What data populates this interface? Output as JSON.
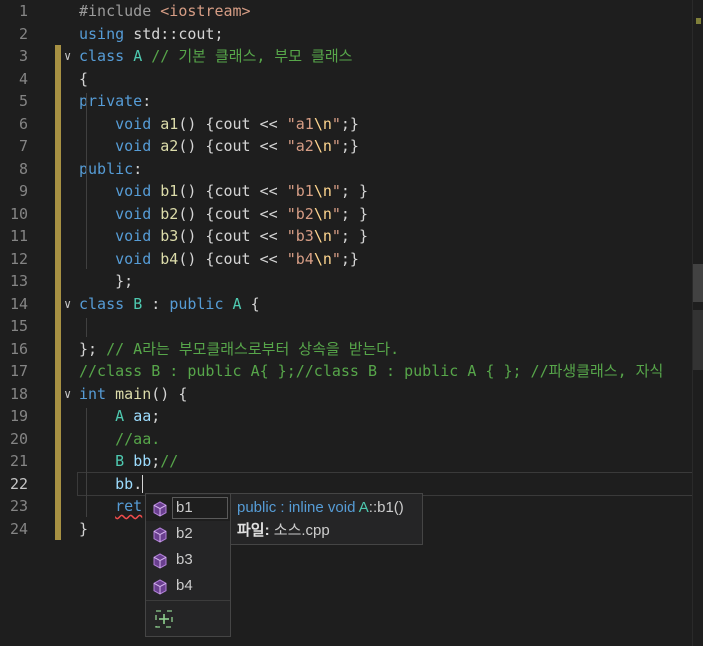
{
  "editor": {
    "current_line": 22,
    "lines": [
      {
        "n": "1",
        "tokens": [
          [
            "pp",
            "#include "
          ],
          [
            "st",
            "<iostream>"
          ]
        ]
      },
      {
        "n": "2",
        "tokens": [
          [
            "kw",
            "using "
          ],
          [
            "pr",
            "std::cout;"
          ]
        ]
      },
      {
        "n": "3",
        "fold": true,
        "tokens": [
          [
            "kw",
            "class "
          ],
          [
            "ty",
            "A"
          ],
          [
            "cm",
            " // 기본 클래스, 부모 클래스"
          ]
        ]
      },
      {
        "n": "4",
        "tokens": [
          [
            "pr",
            "{"
          ]
        ]
      },
      {
        "n": "5",
        "tokens": [
          [
            "kw",
            "private"
          ],
          [
            "pr",
            ":"
          ]
        ]
      },
      {
        "n": "6",
        "tokens": [
          [
            "pr",
            "    "
          ],
          [
            "kw",
            "void "
          ],
          [
            "fn",
            "a1"
          ],
          [
            "pr",
            "() {cout << "
          ],
          [
            "st",
            "\"a1"
          ],
          [
            "es",
            "\\n"
          ],
          [
            "st",
            "\""
          ],
          [
            "pr",
            ";}"
          ]
        ]
      },
      {
        "n": "7",
        "tokens": [
          [
            "pr",
            "    "
          ],
          [
            "kw",
            "void "
          ],
          [
            "fn",
            "a2"
          ],
          [
            "pr",
            "() {cout << "
          ],
          [
            "st",
            "\"a2"
          ],
          [
            "es",
            "\\n"
          ],
          [
            "st",
            "\""
          ],
          [
            "pr",
            ";}"
          ]
        ]
      },
      {
        "n": "8",
        "tokens": [
          [
            "kw",
            "public"
          ],
          [
            "pr",
            ":"
          ]
        ]
      },
      {
        "n": "9",
        "tokens": [
          [
            "pr",
            "    "
          ],
          [
            "kw",
            "void "
          ],
          [
            "fn",
            "b1"
          ],
          [
            "pr",
            "() {cout << "
          ],
          [
            "st",
            "\"b1"
          ],
          [
            "es",
            "\\n"
          ],
          [
            "st",
            "\""
          ],
          [
            "pr",
            "; }"
          ]
        ]
      },
      {
        "n": "10",
        "tokens": [
          [
            "pr",
            "    "
          ],
          [
            "kw",
            "void "
          ],
          [
            "fn",
            "b2"
          ],
          [
            "pr",
            "() {cout << "
          ],
          [
            "st",
            "\"b2"
          ],
          [
            "es",
            "\\n"
          ],
          [
            "st",
            "\""
          ],
          [
            "pr",
            "; }"
          ]
        ]
      },
      {
        "n": "11",
        "tokens": [
          [
            "pr",
            "    "
          ],
          [
            "kw",
            "void "
          ],
          [
            "fn",
            "b3"
          ],
          [
            "pr",
            "() {cout << "
          ],
          [
            "st",
            "\"b3"
          ],
          [
            "es",
            "\\n"
          ],
          [
            "st",
            "\""
          ],
          [
            "pr",
            "; }"
          ]
        ]
      },
      {
        "n": "12",
        "tokens": [
          [
            "pr",
            "    "
          ],
          [
            "kw",
            "void "
          ],
          [
            "fn",
            "b4"
          ],
          [
            "pr",
            "() {cout << "
          ],
          [
            "st",
            "\"b4"
          ],
          [
            "es",
            "\\n"
          ],
          [
            "st",
            "\""
          ],
          [
            "pr",
            ";}"
          ]
        ]
      },
      {
        "n": "13",
        "tokens": [
          [
            "pr",
            "    };"
          ]
        ]
      },
      {
        "n": "14",
        "fold": true,
        "tokens": [
          [
            "kw",
            "class "
          ],
          [
            "ty",
            "B"
          ],
          [
            "pr",
            " : "
          ],
          [
            "kw",
            "public "
          ],
          [
            "ty",
            "A"
          ],
          [
            "pr",
            " {"
          ]
        ]
      },
      {
        "n": "15",
        "tokens": []
      },
      {
        "n": "16",
        "tokens": [
          [
            "pr",
            "}; "
          ],
          [
            "cm",
            "// A라는 부모클래스로부터 상속을 받는다."
          ]
        ]
      },
      {
        "n": "17",
        "tokens": [
          [
            "cm",
            "//class B : public A{ };//class B : public A { }; //파생클래스, 자식"
          ]
        ]
      },
      {
        "n": "18",
        "fold": true,
        "tokens": [
          [
            "kw",
            "int "
          ],
          [
            "fn",
            "main"
          ],
          [
            "pr",
            "() {"
          ]
        ]
      },
      {
        "n": "19",
        "tokens": [
          [
            "pr",
            "    "
          ],
          [
            "ty",
            "A "
          ],
          [
            "va",
            "aa"
          ],
          [
            "pr",
            ";"
          ]
        ]
      },
      {
        "n": "20",
        "tokens": [
          [
            "pr",
            "    "
          ],
          [
            "cm",
            "//aa."
          ]
        ]
      },
      {
        "n": "21",
        "tokens": [
          [
            "pr",
            "    "
          ],
          [
            "ty",
            "B "
          ],
          [
            "va",
            "bb"
          ],
          [
            "pr",
            ";"
          ],
          [
            "cm",
            "//"
          ]
        ]
      },
      {
        "n": "22",
        "tokens": [
          [
            "pr",
            "    "
          ],
          [
            "va",
            "bb"
          ],
          [
            "pr",
            "."
          ]
        ],
        "caret": true
      },
      {
        "n": "23",
        "tokens": [
          [
            "pr",
            "    "
          ],
          [
            "kwsq",
            "ret"
          ]
        ]
      },
      {
        "n": "24",
        "tokens": [
          [
            "pr",
            "}"
          ]
        ]
      }
    ]
  },
  "suggest": {
    "items": [
      "b1",
      "b2",
      "b3",
      "b4"
    ],
    "selected": "b1",
    "icon": "method-cube-icon",
    "footer_icon": "add-member-icon"
  },
  "detail": {
    "signature_keyword": "public",
    "signature_mid": " : inline void ",
    "signature_type": "A",
    "signature_rest": "::b1()",
    "file_label": "파일:",
    "file_name": "소스.cpp"
  },
  "colors": {
    "background": "#1e1e1e",
    "keyword": "#569cd6",
    "type": "#4ec9b0",
    "function": "#dcdcaa",
    "string": "#d69d85",
    "comment": "#57a64a",
    "method_icon": "#b180d7"
  }
}
